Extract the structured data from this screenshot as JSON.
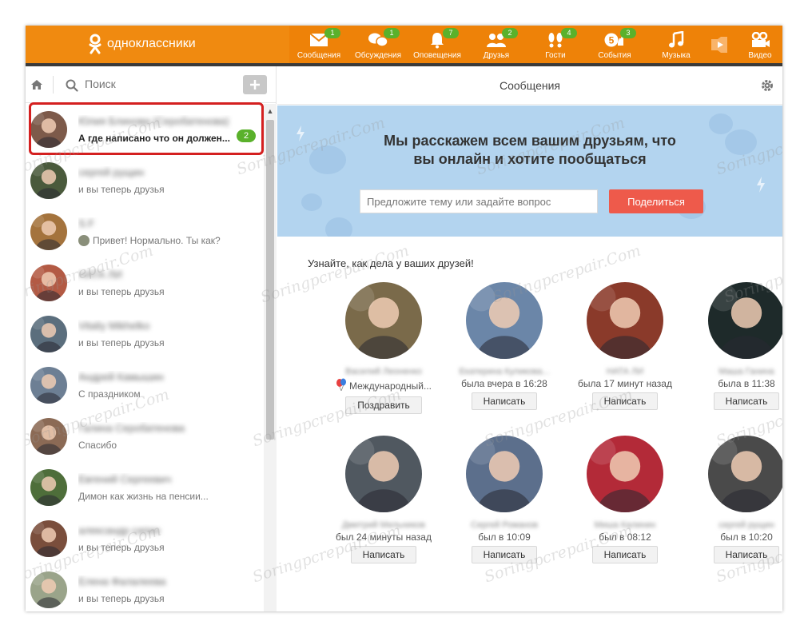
{
  "header": {
    "logo_text": "одноклассники",
    "nav": [
      {
        "id": "messages",
        "label": "Сообщения",
        "badge": "1",
        "icon": "envelope-icon"
      },
      {
        "id": "discussions",
        "label": "Обсуждения",
        "badge": "1",
        "icon": "chat-bubbles-icon"
      },
      {
        "id": "notifications",
        "label": "Оповещения",
        "badge": "7",
        "icon": "bell-icon"
      },
      {
        "id": "friends",
        "label": "Друзья",
        "badge": "2",
        "icon": "people-icon"
      },
      {
        "id": "guests",
        "label": "Гости",
        "badge": "4",
        "icon": "footprints-icon"
      },
      {
        "id": "events",
        "label": "События",
        "badge": "3",
        "icon": "five-plus-icon"
      },
      {
        "id": "music",
        "label": "Музыка",
        "badge": "",
        "icon": "music-note-icon"
      },
      {
        "id": "video",
        "label": "Видео",
        "badge": "",
        "icon": "video-camera-icon"
      }
    ]
  },
  "sidebar": {
    "search_placeholder": "Поиск",
    "chats": [
      {
        "name": "Юлия Блинова (Серобатенова)",
        "message": "А где написано что он должен...",
        "unread": "2",
        "active": true,
        "color": "#7d5a4a"
      },
      {
        "name": "сергей рущин",
        "message": "и вы теперь друзья",
        "unread": "",
        "active": false,
        "color": "#4a5a3c"
      },
      {
        "name": "S.F",
        "message": "Привет! Нормально. Ты как?",
        "unread": "",
        "active": false,
        "color": "#a4733d",
        "mini_avatar": true
      },
      {
        "name": "НАТА ЛИ",
        "message": "и вы теперь друзья",
        "unread": "",
        "active": false,
        "color": "#b35a44"
      },
      {
        "name": "Vitaliy Mikhelko",
        "message": "и вы теперь друзья",
        "unread": "",
        "active": false,
        "color": "#5b6e7d"
      },
      {
        "name": "Андрей Камышин",
        "message": "С праздником",
        "unread": "",
        "active": false,
        "color": "#6d7f94"
      },
      {
        "name": "Галина Серобатенова",
        "message": "Спасибо",
        "unread": "",
        "active": false,
        "color": "#8b6a55"
      },
      {
        "name": "Евгений Сергеевич",
        "message": "Димон как жизнь на пенсии...",
        "unread": "",
        "active": false,
        "color": "#4e6e3a"
      },
      {
        "name": "александр сапин",
        "message": "и вы теперь друзья",
        "unread": "",
        "active": false,
        "color": "#7a4e3c"
      },
      {
        "name": "Елена Фалалеева",
        "message": "и вы теперь друзья",
        "unread": "",
        "active": false,
        "color": "#9aa48a"
      }
    ]
  },
  "main": {
    "title": "Сообщения",
    "banner_title": "Мы расскажем всем вашим друзьям, что вы онлайн и хотите пообщаться",
    "banner_input_placeholder": "Предложите тему или задайте вопрос",
    "share_label": "Поделиться",
    "section_title": "Узнайте, как дела у ваших друзей!",
    "friends": [
      {
        "name": "Василий Леоненко",
        "status": "Международный...",
        "button": "Поздравить",
        "color": "#7a6a4a",
        "balloon": true
      },
      {
        "name": "Екатерина Куликова...",
        "status": "была вчера в 16:28",
        "button": "Написать",
        "color": "#6b86a8"
      },
      {
        "name": "НАТА ЛИ",
        "status": "была 17 минут назад",
        "button": "Написать",
        "color": "#8a3a2a"
      },
      {
        "name": "Маша Ганина",
        "status": "была в 11:38",
        "button": "Написать",
        "color": "#1e2a2a"
      },
      {
        "name": "Дмитрий Мельников",
        "status": "был 24 минуты назад",
        "button": "Написать",
        "color": "#505860"
      },
      {
        "name": "Сергей Романов",
        "status": "был в 10:09",
        "button": "Написать",
        "color": "#5c6f8c"
      },
      {
        "name": "Миша Калинин",
        "status": "был в 08:12",
        "button": "Написать",
        "color": "#b32a38"
      },
      {
        "name": "сергей рущин",
        "status": "был в 10:20",
        "button": "Написать",
        "color": "#4a4a4a"
      }
    ]
  },
  "watermark": "Soringpcrepair.Com"
}
